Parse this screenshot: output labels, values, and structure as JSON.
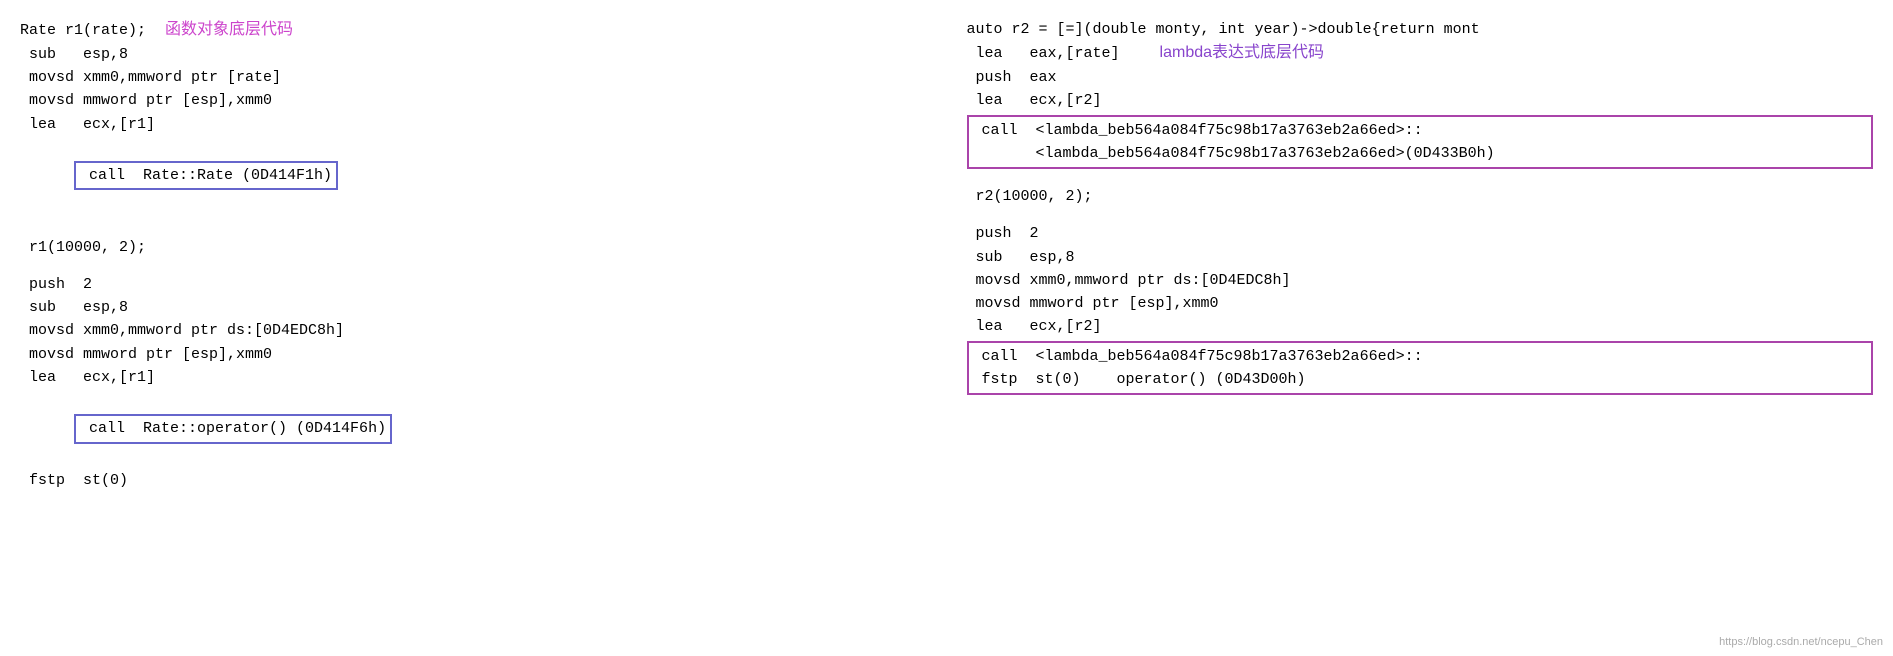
{
  "left_column": {
    "lines_top": [
      {
        "text": "Rate r1(rate); ",
        "label": "函数对象底层代码",
        "label_class": "label-chinese"
      },
      {
        "text": " sub   esp,8"
      },
      {
        "text": " movsd xmm0,mmword ptr [rate]"
      },
      {
        "text": " movsd mmword ptr [esp],xmm0"
      },
      {
        "text": " lea   ecx,[r1]"
      },
      {
        "text": " call  Rate::Rate (0D414F1h)",
        "boxed": true
      }
    ],
    "lines_bottom": [
      {
        "text": " r1(10000, 2);"
      },
      {
        "text": ""
      },
      {
        "text": " push  2"
      },
      {
        "text": " sub   esp,8"
      },
      {
        "text": " movsd xmm0,mmword ptr ds:[0D4EDC8h]"
      },
      {
        "text": " movsd mmword ptr [esp],xmm0"
      },
      {
        "text": " lea   ecx,[r1]"
      },
      {
        "text": " call  Rate::operator() (0D414F6h)",
        "boxed": true
      },
      {
        "text": " fstp  st(0)"
      }
    ]
  },
  "right_column": {
    "line_first": "auto r2 = [=](double monty, int year)->double{return mont",
    "lines_middle": [
      {
        "text": " lea   eax,[rate]"
      },
      {
        "text": " push  eax"
      },
      {
        "text": " lea   ecx,[r2]"
      }
    ],
    "lambda_label": "lambda表达式底层代码",
    "boxed_call_lines": [
      " call  <lambda_beb564a084f75c98b17a3763eb2a66ed>::",
      "       <lambda_beb564a084f75c98b17a3763eb2a66ed>(0D433B0h)"
    ],
    "lines_after_box": [
      {
        "text": ""
      },
      {
        "text": " r2(10000, 2);"
      },
      {
        "text": ""
      },
      {
        "text": " push  2"
      },
      {
        "text": " sub   esp,8"
      },
      {
        "text": " movsd xmm0,mmword ptr ds:[0D4EDC8h]"
      },
      {
        "text": " movsd mmword ptr [esp],xmm0"
      },
      {
        "text": " lea   ecx,[r2]"
      }
    ],
    "boxed_call2_lines": [
      " call  <lambda_beb564a084f75c98b17a3763eb2a66ed>::",
      " fstp  st(0)    operator() (0D43D00h)"
    ]
  },
  "watermark": "https://blog.csdn.net/ncepu_Chen"
}
